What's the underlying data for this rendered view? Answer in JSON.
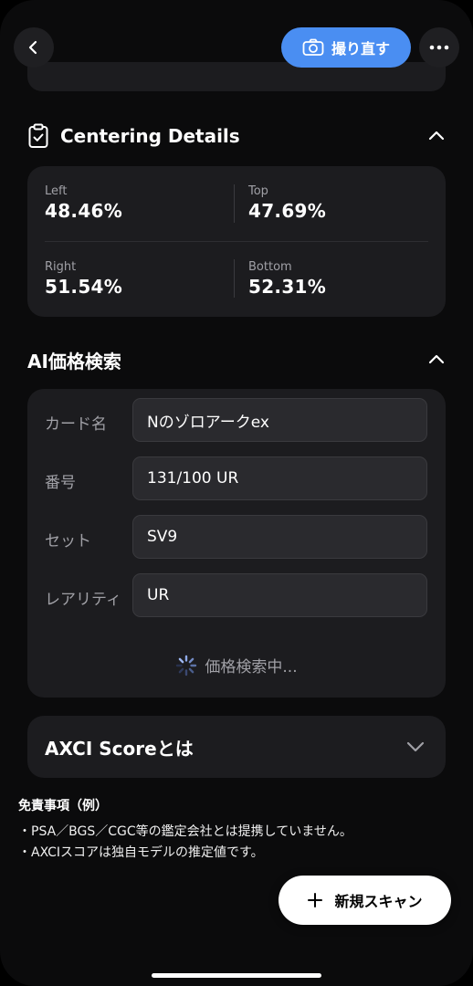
{
  "header": {
    "back_icon": "chevron-left-icon",
    "retake_label": "撮り直す",
    "retake_icon": "camera-icon",
    "more_icon": "ellipsis-icon",
    "accent": "#4a8ef2"
  },
  "centering": {
    "title": "Centering Details",
    "icon": "clipboard-check-icon",
    "left_label": "Left",
    "left_value": "48.46%",
    "top_label": "Top",
    "top_value": "47.69%",
    "right_label": "Right",
    "right_value": "51.54%",
    "bottom_label": "Bottom",
    "bottom_value": "52.31%"
  },
  "price_search": {
    "title": "AI価格検索",
    "fields": [
      {
        "label": "カード名",
        "value": "Nのゾロアークex"
      },
      {
        "label": "番号",
        "value": "131/100 UR"
      },
      {
        "label": "セット",
        "value": "SV9"
      },
      {
        "label": "レアリティ",
        "value": "UR"
      }
    ],
    "loading_text": "価格検索中..."
  },
  "axci": {
    "title": "AXCI Scoreとは"
  },
  "disclaimer": {
    "title": "免責事項（例）",
    "lines": [
      "・PSA／BGS／CGC等の鑑定会社とは提携していません。",
      "・AXCIスコアは独自モデルの推定値です。"
    ]
  },
  "fab": {
    "label": "新規スキャン",
    "icon": "plus-icon"
  }
}
